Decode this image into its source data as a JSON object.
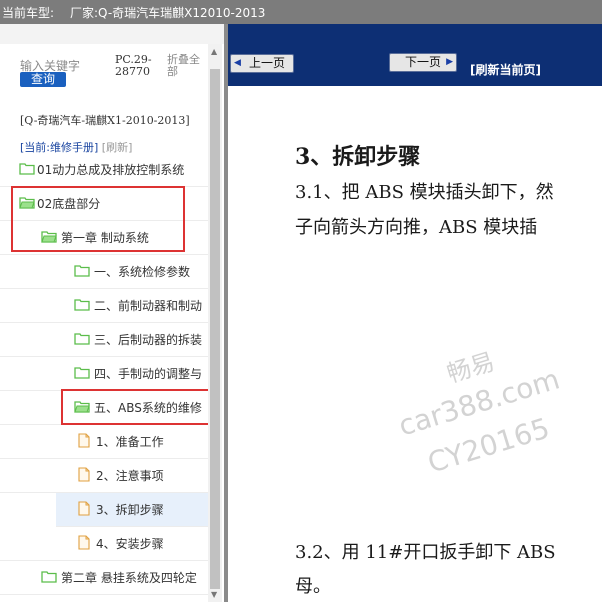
{
  "titlebar": {
    "model_label": "当前车型:",
    "maker": "厂家:Q-奇瑞汽车瑞麒X12010-2013"
  },
  "sidebar": {
    "search_placeholder": "输入关键字",
    "search_button": "查询",
    "pc_code": "PC.29-28770",
    "collapse_all": "折叠全部",
    "current_model": "[Q-奇瑞汽车-瑞麒X1-2010-2013]",
    "current_label": "[当前:",
    "current_value": "维修手册]",
    "refresh_link": "[刷新]",
    "tree": [
      {
        "label": "01动力总成及排放控制系统",
        "type": "folder"
      },
      {
        "label": "02底盘部分",
        "type": "folder"
      },
      {
        "label": "第一章 制动系统",
        "type": "folder"
      },
      {
        "label": "一、系统检修参数",
        "type": "folder"
      },
      {
        "label": "二、前制动器和制动",
        "type": "folder"
      },
      {
        "label": "三、后制动器的拆装",
        "type": "folder"
      },
      {
        "label": "四、手制动的调整与",
        "type": "folder"
      },
      {
        "label": "五、ABS系统的维修",
        "type": "folder"
      },
      {
        "label": "1、准备工作",
        "type": "page"
      },
      {
        "label": "2、注意事项",
        "type": "page"
      },
      {
        "label": "3、拆卸步骤",
        "type": "page",
        "selected": true
      },
      {
        "label": "4、安装步骤",
        "type": "page"
      },
      {
        "label": "第二章 悬挂系统及四轮定",
        "type": "folder"
      }
    ]
  },
  "toolbar": {
    "prev": "上一页",
    "next": "下一页",
    "refresh": "[刷新当前页]"
  },
  "document": {
    "heading": "3、拆卸步骤",
    "para1_line1": "3.1、把 ABS 模块插头卸下，然",
    "para1_line2": "子向箭头方向推，ABS 模块插",
    "para2_line1": "3.2、用 11#开口扳手卸下 ABS",
    "para2_line2": "母。"
  },
  "watermark": {
    "line1": "畅易",
    "line2": "car388.com",
    "line3": "CY20165"
  },
  "colors": {
    "titlebar": "#7c7c7c",
    "toolbar": "#0d2f74",
    "highlight": "#dd3333",
    "folder": "#5bbd4a",
    "search_button": "#1a60bf"
  }
}
